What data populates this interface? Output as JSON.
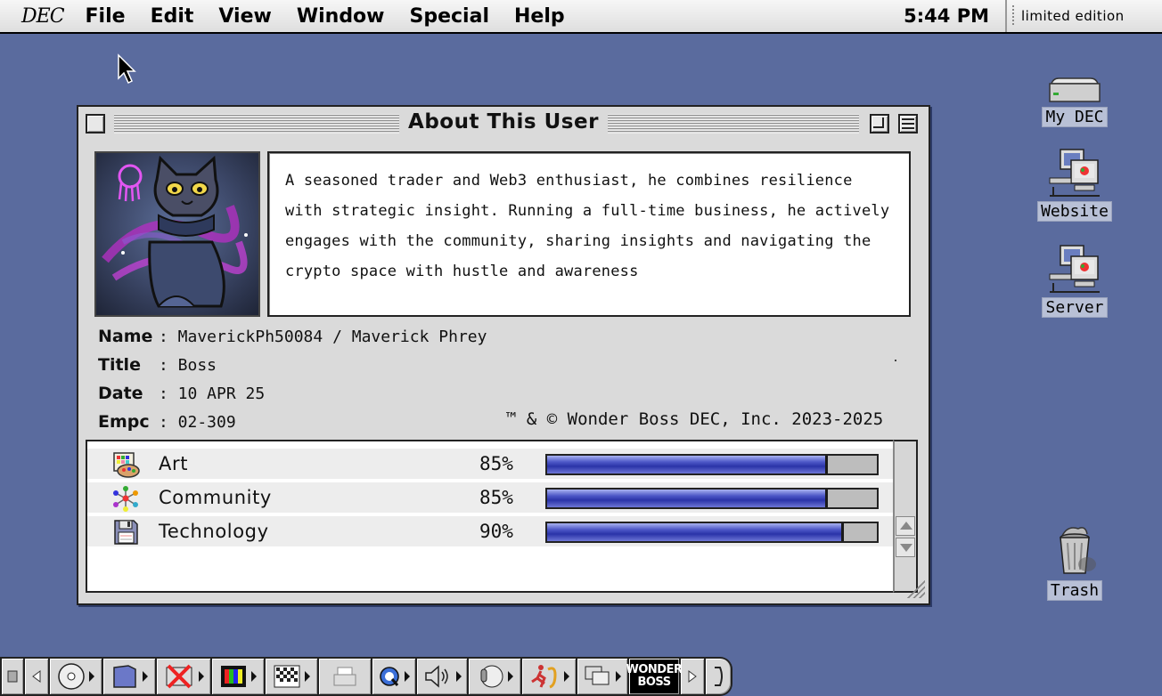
{
  "menubar": {
    "logo": "DEC",
    "items": [
      "File",
      "Edit",
      "View",
      "Window",
      "Special",
      "Help"
    ],
    "clock": "5:44 PM",
    "app_name": "limited edition"
  },
  "window": {
    "title": "About This User",
    "bio": "A seasoned trader and Web3 enthusiast, he combines resilience with strategic insight. Running a full-time business, he actively engages with the community, sharing insights and navigating the crypto space with hustle and awareness",
    "fields": [
      {
        "label": "Name",
        "value": ": MaverickPh50084 / Maverick Phrey"
      },
      {
        "label": "Title",
        "value": ": Boss"
      },
      {
        "label": "Date",
        "value": ": 10 APR 25"
      },
      {
        "label": "Empc",
        "value": ": 02-309"
      }
    ],
    "copyright": "™ & © Wonder Boss DEC, Inc. 2023-2025",
    "skills": [
      {
        "name": "Art",
        "percent_label": "85%",
        "value": 85,
        "icon": "palette-icon"
      },
      {
        "name": "Community",
        "percent_label": "85%",
        "value": 85,
        "icon": "network-icon"
      },
      {
        "name": "Technology",
        "percent_label": "90%",
        "value": 90,
        "icon": "floppy-disk-icon"
      }
    ]
  },
  "desktop": {
    "icons": [
      {
        "label": "My DEC",
        "icon": "hard-drive-icon"
      },
      {
        "label": "Website",
        "icon": "network-computers-icon"
      },
      {
        "label": "Server",
        "icon": "network-computers-icon"
      },
      {
        "label": "Trash",
        "icon": "trash-icon"
      }
    ]
  },
  "control_strip": {
    "boss_label": "WONDER BOSS"
  },
  "colors": {
    "desktop": "#5a6b9e",
    "bar_fill": "#2a33a8",
    "window_bg": "#dadada"
  }
}
